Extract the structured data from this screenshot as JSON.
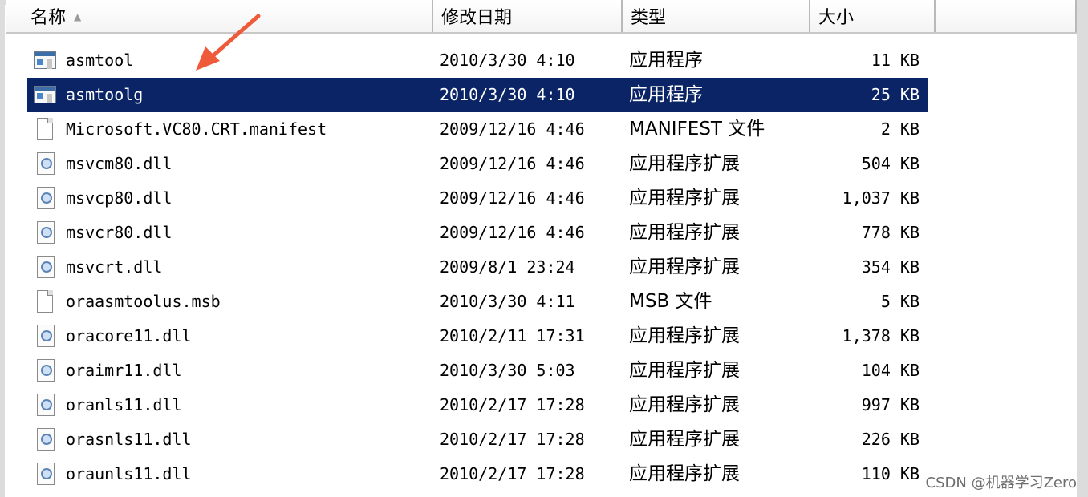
{
  "header": {
    "name": "名称",
    "date": "修改日期",
    "type": "类型",
    "size": "大小"
  },
  "files": [
    {
      "name": "asmtool",
      "date": "2010/3/30 4:10",
      "type": "应用程序",
      "size": "11 KB",
      "icon": "app-icon"
    },
    {
      "name": "asmtoolg",
      "date": "2010/3/30 4:10",
      "type": "应用程序",
      "size": "25 KB",
      "icon": "app-icon",
      "selected": true
    },
    {
      "name": "Microsoft.VC80.CRT.manifest",
      "date": "2009/12/16 4:46",
      "type": "MANIFEST 文件",
      "size": "2 KB",
      "icon": "file-icon"
    },
    {
      "name": "msvcm80.dll",
      "date": "2009/12/16 4:46",
      "type": "应用程序扩展",
      "size": "504 KB",
      "icon": "dll-icon"
    },
    {
      "name": "msvcp80.dll",
      "date": "2009/12/16 4:46",
      "type": "应用程序扩展",
      "size": "1,037 KB",
      "icon": "dll-icon"
    },
    {
      "name": "msvcr80.dll",
      "date": "2009/12/16 4:46",
      "type": "应用程序扩展",
      "size": "778 KB",
      "icon": "dll-icon"
    },
    {
      "name": "msvcrt.dll",
      "date": "2009/8/1 23:24",
      "type": "应用程序扩展",
      "size": "354 KB",
      "icon": "dll-icon"
    },
    {
      "name": "oraasmtoolus.msb",
      "date": "2010/3/30 4:11",
      "type": "MSB 文件",
      "size": "5 KB",
      "icon": "file-icon"
    },
    {
      "name": "oracore11.dll",
      "date": "2010/2/11 17:31",
      "type": "应用程序扩展",
      "size": "1,378 KB",
      "icon": "dll-icon"
    },
    {
      "name": "oraimr11.dll",
      "date": "2010/3/30 5:03",
      "type": "应用程序扩展",
      "size": "104 KB",
      "icon": "dll-icon"
    },
    {
      "name": "oranls11.dll",
      "date": "2010/2/17 17:28",
      "type": "应用程序扩展",
      "size": "997 KB",
      "icon": "dll-icon"
    },
    {
      "name": "orasnls11.dll",
      "date": "2010/2/17 17:28",
      "type": "应用程序扩展",
      "size": "226 KB",
      "icon": "dll-icon"
    },
    {
      "name": "oraunls11.dll",
      "date": "2010/2/17 17:28",
      "type": "应用程序扩展",
      "size": "110 KB",
      "icon": "dll-icon"
    }
  ],
  "annotation": {
    "color": "#ef5a3a"
  },
  "selection_color": "#0a2466",
  "watermark": "CSDN @机器学习Zero"
}
